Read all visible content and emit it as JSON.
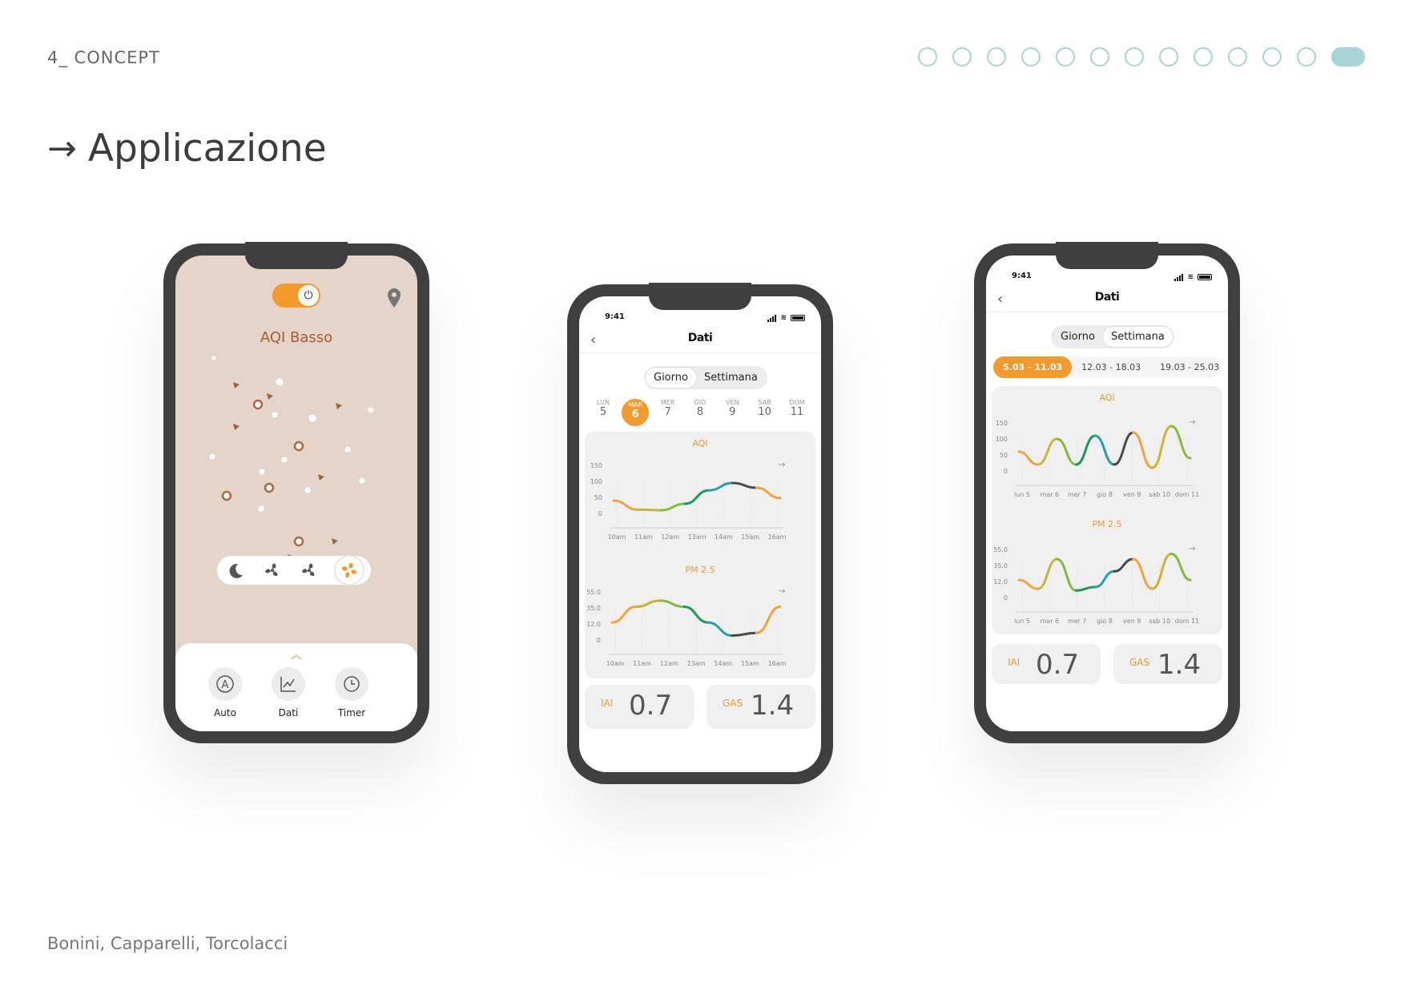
{
  "section": "4_ CONCEPT",
  "pager": {
    "count": 13,
    "active": 12
  },
  "title": {
    "arrow": "→",
    "text": "Applicazione"
  },
  "authors": "Bonini, Capparelli, Torcolacci",
  "colors": {
    "accent": "#f39a2c",
    "teal": "#a7d4d7",
    "frame": "#3f3f3f",
    "home_bg": "#e4d4ca",
    "aqi_text": "#a75d32"
  },
  "home": {
    "aqi_label": "AQI Basso",
    "toggle_icon": "power-icon",
    "location_icon": "pin-icon",
    "modes": [
      "moon-icon",
      "fan-icon",
      "fan-icon",
      "fan-active-icon"
    ],
    "actions": [
      {
        "label": "Auto",
        "icon": "auto-icon"
      },
      {
        "label": "Dati",
        "icon": "chart-icon"
      },
      {
        "label": "Timer",
        "icon": "clock-icon"
      }
    ]
  },
  "day_view": {
    "time": "9:41",
    "title": "Dati",
    "tabs": [
      "Giorno",
      "Settimana"
    ],
    "active_tab": "Settimana",
    "days": [
      {
        "name": "LUN",
        "num": "5"
      },
      {
        "name": "MAR",
        "num": "6"
      },
      {
        "name": "MER",
        "num": "7"
      },
      {
        "name": "GIO",
        "num": "8"
      },
      {
        "name": "VEN",
        "num": "9"
      },
      {
        "name": "SAB",
        "num": "10"
      },
      {
        "name": "DOM",
        "num": "11"
      }
    ],
    "active_day": "MAR",
    "aqi_title": "AQI",
    "pm_title": "PM 2.5",
    "iai": {
      "label": "IAI",
      "value": "0.7"
    },
    "gas": {
      "label": "GAS",
      "value": "1.4"
    }
  },
  "week_view": {
    "time": "9:41",
    "title": "Dati",
    "tabs": [
      "Giorno",
      "Settimana"
    ],
    "active_tab": "Settimana",
    "weeks": [
      "5.03 - 11.03",
      "12.03 - 18.03",
      "19.03 - 25.03"
    ],
    "active_week": "5.03 - 11.03",
    "aqi_title": "AQI",
    "pm_title": "PM 2.5",
    "iai": {
      "label": "IAI",
      "value": "0.7"
    },
    "gas": {
      "label": "GAS",
      "value": "1.4"
    }
  },
  "chart_data": [
    {
      "type": "line",
      "title": "AQI",
      "x": [
        "10am",
        "11am",
        "12am",
        "13am",
        "14am",
        "15am",
        "16am"
      ],
      "yticks": [
        "150",
        "100",
        "50",
        "0"
      ],
      "ylim": [
        0,
        150
      ],
      "values": [
        40,
        12,
        10,
        30,
        72,
        95,
        80,
        48
      ]
    },
    {
      "type": "line",
      "title": "PM 2.5",
      "x": [
        "10am",
        "11am",
        "12am",
        "13am",
        "14am",
        "15am",
        "16am"
      ],
      "yticks": [
        "55.0",
        "35.0",
        "12.0",
        "0"
      ],
      "ylim": [
        0,
        55
      ],
      "values": [
        20,
        38,
        45,
        38,
        20,
        5,
        8,
        38
      ]
    },
    {
      "type": "line",
      "title": "AQI",
      "x": [
        "lun 5",
        "mar 6",
        "mer 7",
        "gio 8",
        "ven 9",
        "sab 10",
        "dom 11"
      ],
      "yticks": [
        "150",
        "100",
        "50",
        "0"
      ],
      "ylim": [
        0,
        150
      ],
      "values": [
        60,
        20,
        100,
        20,
        110,
        20,
        120,
        10,
        140,
        40
      ]
    },
    {
      "type": "line",
      "title": "PM 2.5",
      "x": [
        "lun 5",
        "mar 6",
        "mer 7",
        "gio 8",
        "ven 9",
        "sab 10",
        "dom 11"
      ],
      "yticks": [
        "55.0",
        "35.0",
        "12.0",
        "0"
      ],
      "ylim": [
        0,
        55
      ],
      "values": [
        20,
        10,
        44,
        8,
        12,
        30,
        44,
        10,
        50,
        20
      ]
    }
  ]
}
